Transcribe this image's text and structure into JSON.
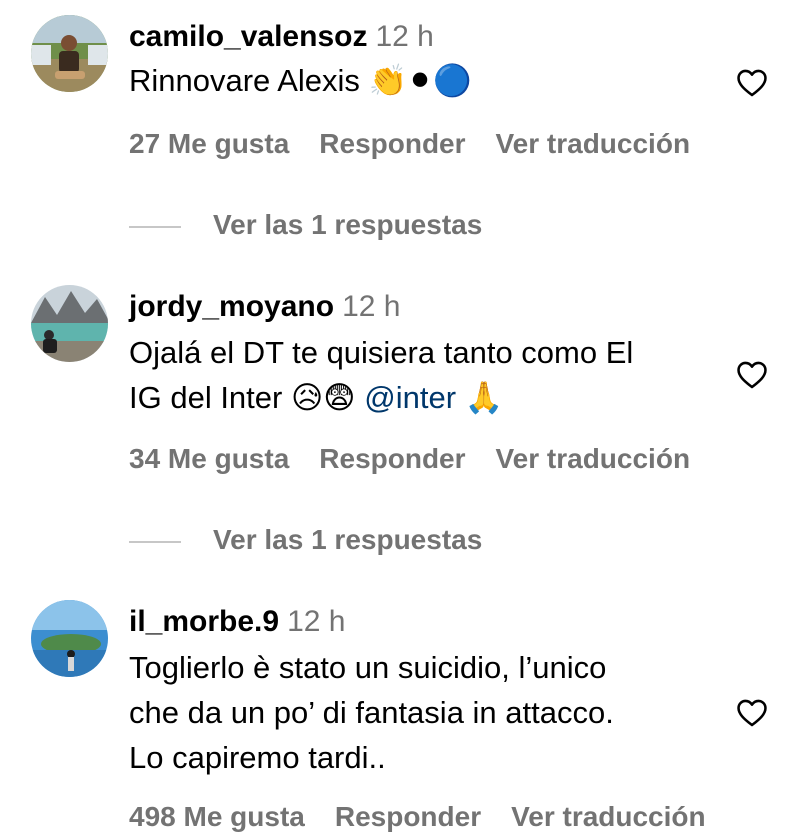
{
  "colors": {
    "text": "#000000",
    "secondary": "#737373",
    "mention": "#00376b",
    "divider": "#c7c7c7"
  },
  "comments": [
    {
      "username": "camilo_valensoz",
      "time": "12 h",
      "text": "Rinnovare Alexis",
      "emojis": "👏⚫🔵",
      "likes": "27 Me gusta",
      "reply": "Responder",
      "translate": "Ver traducción",
      "view_replies": "Ver las 1 respuestas",
      "heart_icon": "heart-outline-icon"
    },
    {
      "username": "jordy_moyano",
      "time": "12 h",
      "text_line1": "Ojalá el DT te quisiera tanto como El",
      "text_line2_prefix": "IG del Inter",
      "text_line2_emojis": "😥😨",
      "mention": "@inter",
      "trailing_emoji": "🙏",
      "likes": "34 Me gusta",
      "reply": "Responder",
      "translate": "Ver traducción",
      "view_replies": "Ver las 1 respuestas",
      "heart_icon": "heart-outline-icon"
    },
    {
      "username": "il_morbe.9",
      "time": "12 h",
      "text": "Toglierlo è stato un suicidio, l’unico\nche da un po’ di fantasia in attacco.\nLo capiremo tardi..",
      "likes": "498 Me gusta",
      "reply": "Responder",
      "translate": "Ver traducción",
      "heart_icon": "heart-outline-icon"
    }
  ]
}
